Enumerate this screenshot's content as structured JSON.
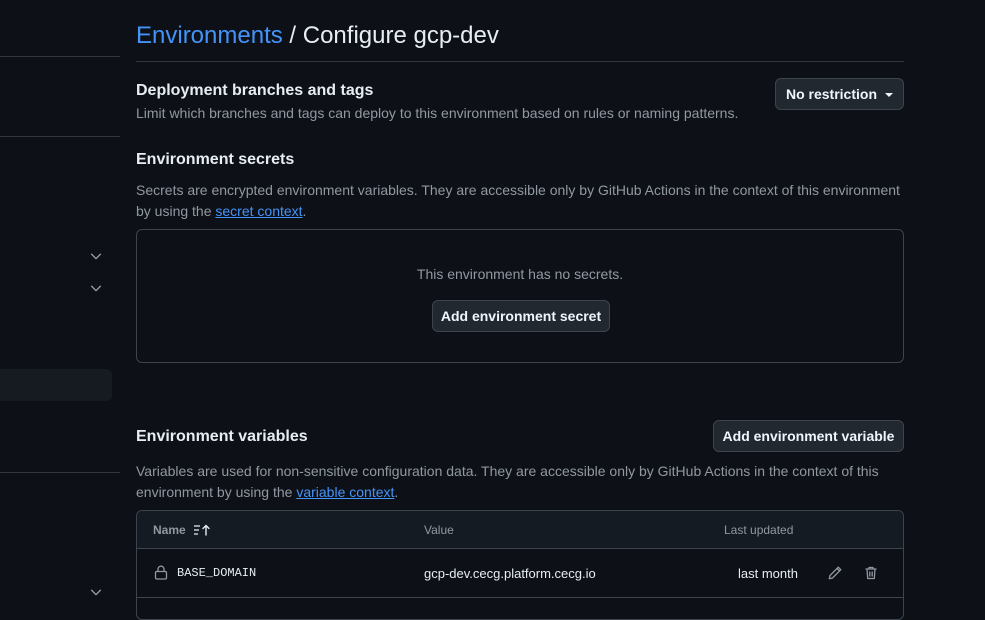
{
  "header": {
    "breadcrumb_link": "Environments",
    "separator": " / ",
    "title": "Configure gcp-dev"
  },
  "deployment": {
    "heading": "Deployment branches and tags",
    "description": "Limit which branches and tags can deploy to this environment based on rules or naming patterns.",
    "dropdown_label": "No restriction"
  },
  "secrets": {
    "heading": "Environment secrets",
    "description_before": "Secrets are encrypted environment variables. They are accessible only by GitHub Actions in the context of this environment by using the ",
    "link": "secret context",
    "description_after": ".",
    "empty_text": "This environment has no secrets.",
    "add_button": "Add environment secret"
  },
  "variables": {
    "heading": "Environment variables",
    "add_button": "Add environment variable",
    "description_before": "Variables are used for non-sensitive configuration data. They are accessible only by GitHub Actions in the context of this environment by using the ",
    "link": "variable context",
    "description_after": ".",
    "columns": {
      "name": "Name",
      "value": "Value",
      "updated": "Last updated"
    },
    "rows": [
      {
        "name": "BASE_DOMAIN",
        "value": "gcp-dev.cecg.platform.cecg.io",
        "updated": "last month"
      }
    ]
  },
  "icons": {
    "sort": "sort-ascending-icon",
    "lock": "lock-icon",
    "edit": "pencil-icon",
    "delete": "trash-icon",
    "chevron": "chevron-down-icon"
  },
  "colors": {
    "background": "#0d1117",
    "link": "#4493f8",
    "border": "#3d444d",
    "muted_text": "#9198a1"
  }
}
